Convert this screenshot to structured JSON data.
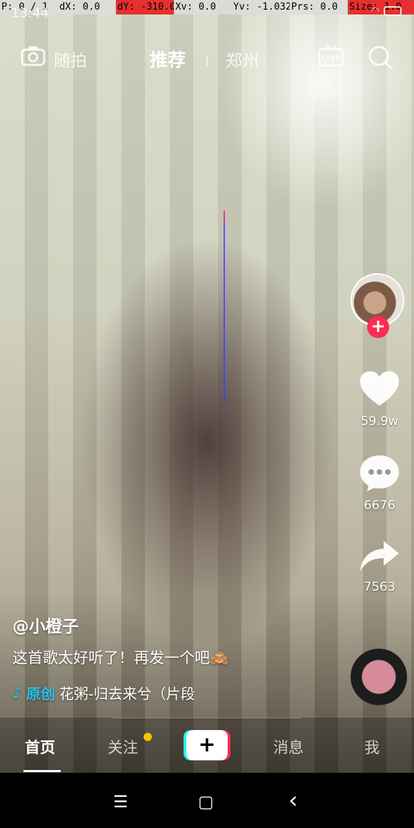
{
  "debug": {
    "p": "P: 0 / 1",
    "dx": "dX: 0.0",
    "dy": "dY: -310.0",
    "xv": "Xv: 0.0",
    "yv": "Yv: -1.032",
    "prs": "Prs: 0.0",
    "size": "Size: 1.0",
    "alert_color": "#e5302f"
  },
  "status": {
    "time": "13:44"
  },
  "top_bar": {
    "camera_label": "随拍",
    "tab_recommend": "推荐",
    "tab_city": "郑州",
    "live_icon": "live-icon",
    "search_icon": "search-icon"
  },
  "actions": {
    "likes": "59.9w",
    "comments": "6676",
    "shares": "7563"
  },
  "post": {
    "author": "@小橙子",
    "caption": "这首歌太好听了！再发一个吧🙈",
    "music_tag": "原创",
    "music_title": "花粥-归去来兮（片段"
  },
  "tabs": {
    "home": "首页",
    "follow": "关注",
    "add": "+",
    "messages": "消息",
    "me": "我"
  },
  "colors": {
    "accent_red": "#fe2c55",
    "accent_cyan": "#25f4ee",
    "music_blue": "#25c4f0",
    "notify_yellow": "#f6c300"
  },
  "nav": {
    "menu": "☰",
    "home": "▢",
    "back": "‹"
  }
}
